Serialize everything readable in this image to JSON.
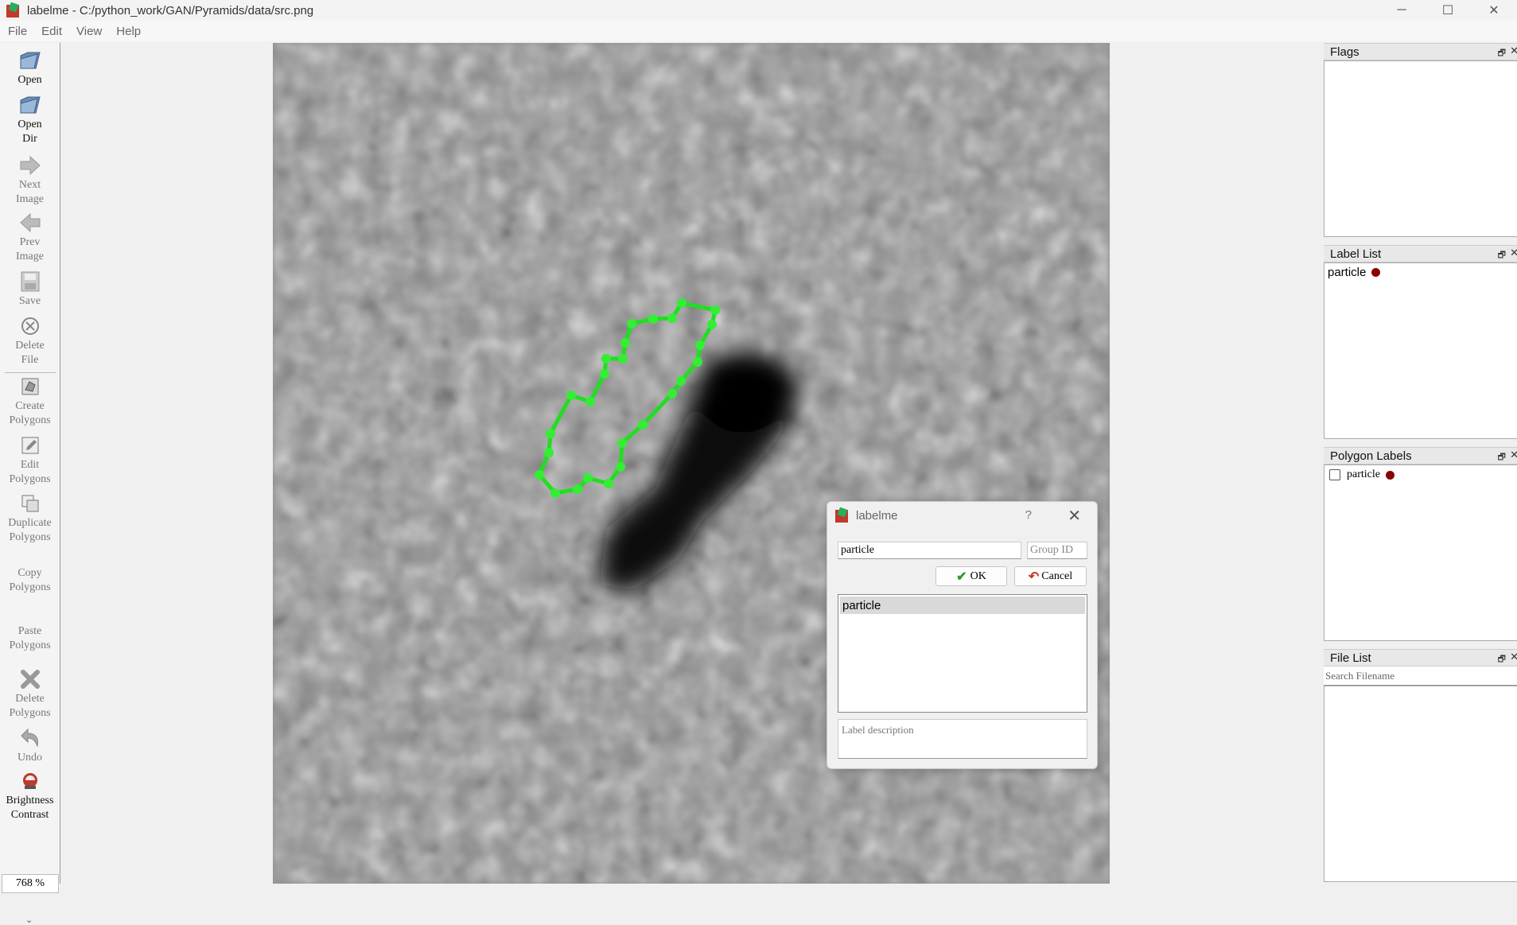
{
  "window": {
    "title": "labelme - C:/python_work/GAN/Pyramids/data/src.png",
    "controls": [
      "─",
      "☐",
      "✕"
    ]
  },
  "menu": [
    "File",
    "Edit",
    "View",
    "Help"
  ],
  "toolbar": {
    "open": "Open",
    "open_dir": "Open Dir",
    "next_image": "Next Image",
    "prev_image": "Prev Image",
    "save": "Save",
    "delete_file": "Delete File",
    "create_polygons": "Create Polygons",
    "edit_polygons": "Edit Polygons",
    "duplicate_polygons": "Duplicate Polygons",
    "copy_polygons": "Copy Polygons",
    "paste_polygons": "Paste Polygons",
    "delete_polygons": "Delete Polygons",
    "undo": "Undo",
    "brightness_contrast": "Brightness Contrast",
    "zoom": "768 %",
    "more": "⌄"
  },
  "docks": {
    "flags": {
      "title": "Flags"
    },
    "label_list": {
      "title": "Label List",
      "items": [
        {
          "label": "particle",
          "color": "#8b0000"
        }
      ]
    },
    "polygon_labels": {
      "title": "Polygon Labels",
      "items": [
        {
          "label": "particle",
          "checked": false,
          "color": "#8b0000"
        }
      ]
    },
    "file_list": {
      "title": "File List",
      "search_placeholder": "Search Filename"
    },
    "float_glyph": "🗗",
    "close_glyph": "✕"
  },
  "dialog": {
    "title": "labelme",
    "help": "?",
    "close": "✕",
    "label_value": "particle",
    "group_id_placeholder": "Group ID",
    "ok_label": "OK",
    "cancel_label": "Cancel",
    "ok_icon": "✔",
    "cancel_icon": "↶",
    "list_items": [
      "particle"
    ],
    "description_placeholder": "Label description"
  },
  "colors": {
    "polygon": "#22dd22",
    "polygon_vertex": "#33ee33",
    "label_dot": "#8b0000"
  },
  "polygon_vertex_count": 29
}
